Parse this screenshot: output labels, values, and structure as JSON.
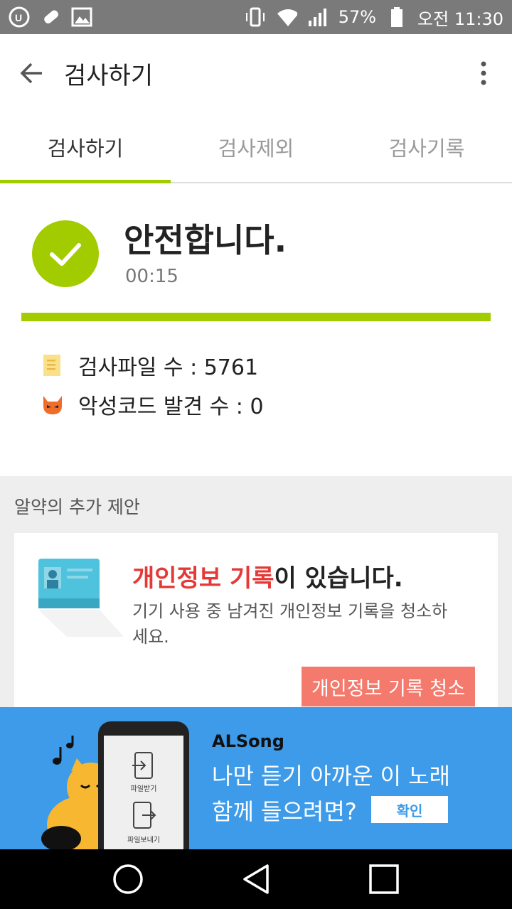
{
  "status_bar": {
    "icons_left": [
      "uplus-icon",
      "pill-icon",
      "image-icon"
    ],
    "icons_right": [
      "vibrate-icon",
      "wifi-icon",
      "signal-icon",
      "battery-icon"
    ],
    "battery": "57%",
    "time": "오전 11:30"
  },
  "app_bar": {
    "title": "검사하기"
  },
  "tabs": [
    {
      "label": "검사하기",
      "active": true
    },
    {
      "label": "검사제외",
      "active": false
    },
    {
      "label": "검사기록",
      "active": false
    }
  ],
  "result": {
    "status": "안전합니다.",
    "elapsed": "00:15",
    "progress": 1.0,
    "files_scanned": "검사파일 수 : 5761",
    "malware_found": "악성코드 발견 수 : 0"
  },
  "suggestions": {
    "header": "알약의 추가 제안",
    "card": {
      "title_highlight": "개인정보 기록",
      "title_rest": "이 있습니다.",
      "description": "기기 사용 중 남겨진 개인정보 기록을 청소하세요.",
      "button": "개인정보 기록 청소"
    }
  },
  "ad": {
    "brand": "ALSong",
    "line1": "나만 듣기 아까운 이 노래",
    "line2": "함께 들으려면?",
    "button": "확인",
    "phone_label1": "파일받기",
    "phone_label2": "파일보내기"
  },
  "colors": {
    "accent": "#a3cc00",
    "danger": "#e53935",
    "button": "#f47a6d",
    "ad_bg": "#3d9be9"
  }
}
